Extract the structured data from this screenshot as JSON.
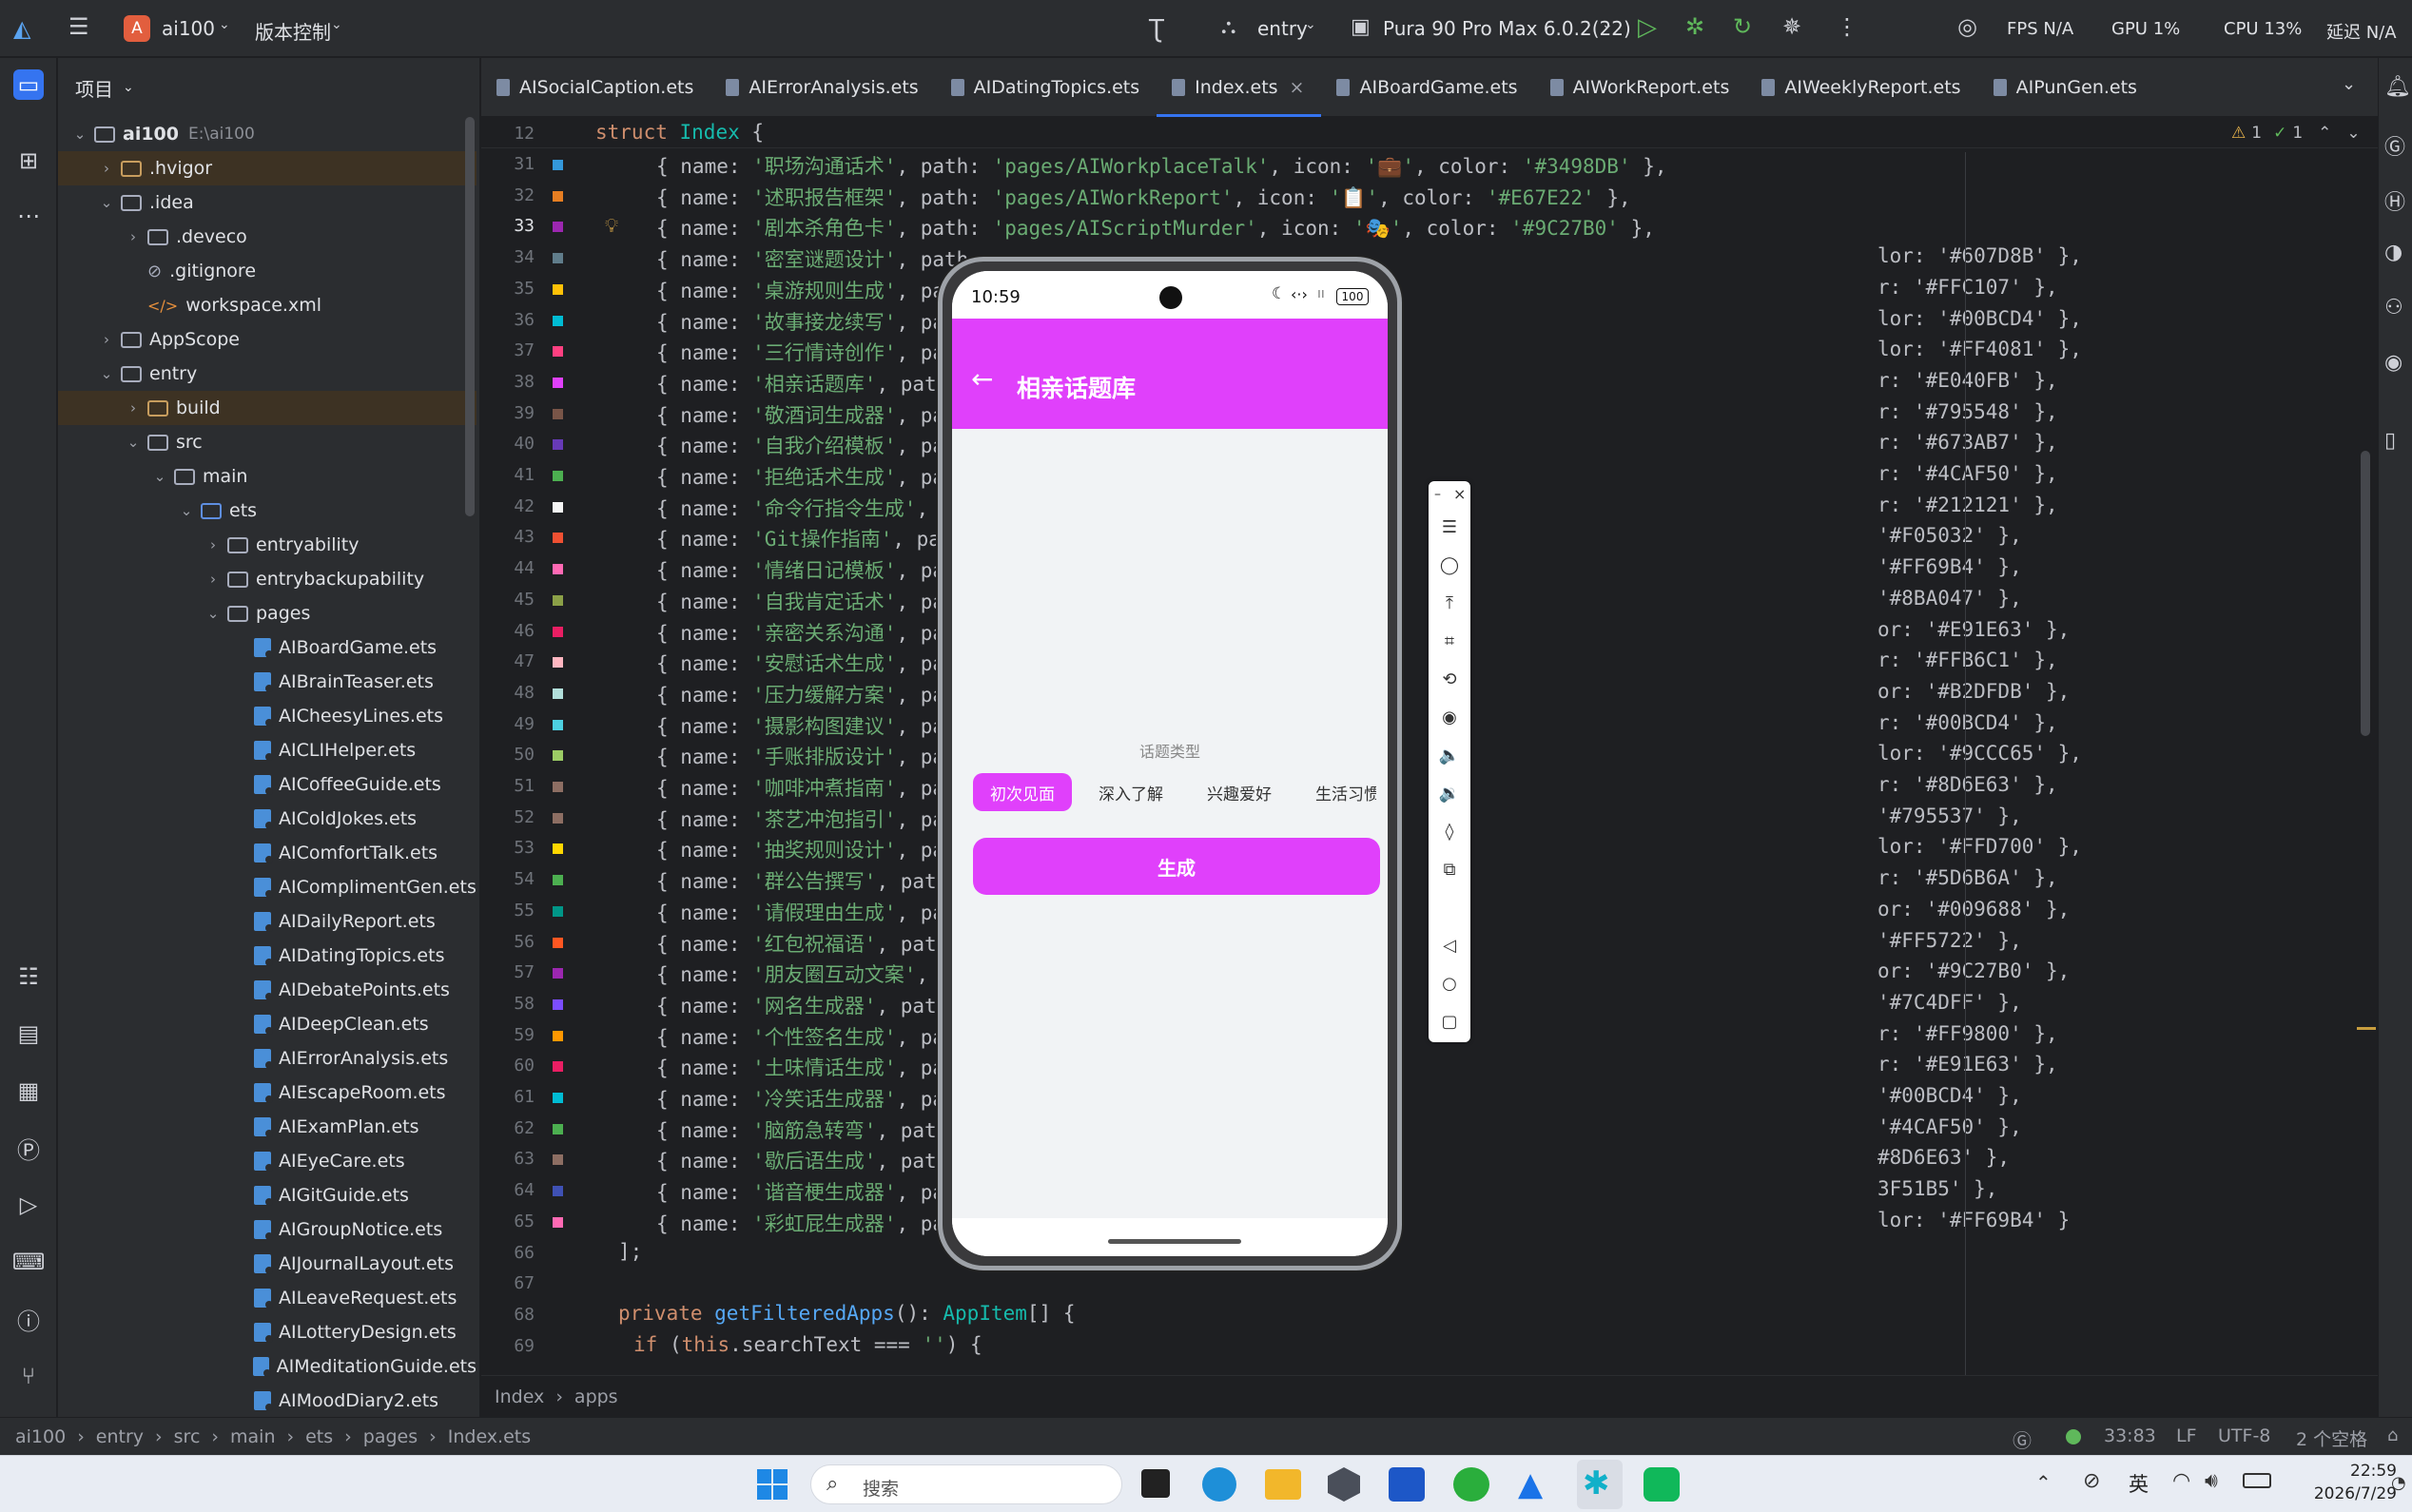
{
  "titlebar": {
    "project_badge": "A",
    "project_name": "ai100",
    "vcs": "版本控制",
    "run_config": "entry",
    "device": "Pura 90 Pro Max 6.0.2(22)",
    "fps": "FPS N/A",
    "gpu": "GPU 1%",
    "cpu": "CPU 13%",
    "latency": "延迟 N/A"
  },
  "project_panel": {
    "title": "项目",
    "tree": [
      {
        "label": "ai100",
        "hint": "E:\\ai100",
        "depth": 0,
        "kind": "root",
        "open": true
      },
      {
        "label": ".hvigor",
        "depth": 1,
        "kind": "folder-orange",
        "open": false
      },
      {
        "label": ".idea",
        "depth": 1,
        "kind": "folder",
        "open": true
      },
      {
        "label": ".deveco",
        "depth": 2,
        "kind": "folder",
        "open": false
      },
      {
        "label": ".gitignore",
        "depth": 2,
        "kind": "ignore"
      },
      {
        "label": "workspace.xml",
        "depth": 2,
        "kind": "xml"
      },
      {
        "label": "AppScope",
        "depth": 1,
        "kind": "folder",
        "open": false
      },
      {
        "label": "entry",
        "depth": 1,
        "kind": "folder",
        "open": true
      },
      {
        "label": "build",
        "depth": 2,
        "kind": "folder-orange",
        "open": false
      },
      {
        "label": "src",
        "depth": 2,
        "kind": "folder",
        "open": true
      },
      {
        "label": "main",
        "depth": 3,
        "kind": "folder",
        "open": true
      },
      {
        "label": "ets",
        "depth": 4,
        "kind": "folder-blue",
        "open": true
      },
      {
        "label": "entryability",
        "depth": 5,
        "kind": "folder",
        "open": false
      },
      {
        "label": "entrybackupability",
        "depth": 5,
        "kind": "folder",
        "open": false
      },
      {
        "label": "pages",
        "depth": 5,
        "kind": "folder",
        "open": true
      },
      {
        "label": "AIBoardGame.ets",
        "depth": 6,
        "kind": "ets"
      },
      {
        "label": "AIBrainTeaser.ets",
        "depth": 6,
        "kind": "ets"
      },
      {
        "label": "AICheesyLines.ets",
        "depth": 6,
        "kind": "ets"
      },
      {
        "label": "AICLIHelper.ets",
        "depth": 6,
        "kind": "ets"
      },
      {
        "label": "AICoffeeGuide.ets",
        "depth": 6,
        "kind": "ets"
      },
      {
        "label": "AIColdJokes.ets",
        "depth": 6,
        "kind": "ets"
      },
      {
        "label": "AIComfortTalk.ets",
        "depth": 6,
        "kind": "ets"
      },
      {
        "label": "AIComplimentGen.ets",
        "depth": 6,
        "kind": "ets"
      },
      {
        "label": "AIDailyReport.ets",
        "depth": 6,
        "kind": "ets"
      },
      {
        "label": "AIDatingTopics.ets",
        "depth": 6,
        "kind": "ets"
      },
      {
        "label": "AIDebatePoints.ets",
        "depth": 6,
        "kind": "ets"
      },
      {
        "label": "AIDeepClean.ets",
        "depth": 6,
        "kind": "ets"
      },
      {
        "label": "AIErrorAnalysis.ets",
        "depth": 6,
        "kind": "ets"
      },
      {
        "label": "AIEscapeRoom.ets",
        "depth": 6,
        "kind": "ets"
      },
      {
        "label": "AIExamPlan.ets",
        "depth": 6,
        "kind": "ets"
      },
      {
        "label": "AIEyeCare.ets",
        "depth": 6,
        "kind": "ets"
      },
      {
        "label": "AIGitGuide.ets",
        "depth": 6,
        "kind": "ets"
      },
      {
        "label": "AIGroupNotice.ets",
        "depth": 6,
        "kind": "ets"
      },
      {
        "label": "AIJournalLayout.ets",
        "depth": 6,
        "kind": "ets"
      },
      {
        "label": "AILeaveRequest.ets",
        "depth": 6,
        "kind": "ets"
      },
      {
        "label": "AILotteryDesign.ets",
        "depth": 6,
        "kind": "ets"
      },
      {
        "label": "AIMeditationGuide.ets",
        "depth": 6,
        "kind": "ets"
      },
      {
        "label": "AIMoodDiary2.ets",
        "depth": 6,
        "kind": "ets"
      }
    ]
  },
  "tabs": [
    {
      "label": "AISocialCaption.ets"
    },
    {
      "label": "AIErrorAnalysis.ets"
    },
    {
      "label": "AIDatingTopics.ets"
    },
    {
      "label": "Index.ets",
      "active": true
    },
    {
      "label": "AIBoardGame.ets"
    },
    {
      "label": "AIWorkReport.ets"
    },
    {
      "label": "AIWeeklyReport.ets"
    },
    {
      "label": "AIPunGen.ets"
    }
  ],
  "editor": {
    "inspections": {
      "warnings": "1",
      "ok": "1"
    },
    "sticky": {
      "line": "12",
      "code": "struct Index {"
    },
    "apps": [
      {
        "line": "31",
        "name": "职场沟通话术",
        "path": "pages/AIWorkplaceTalk",
        "icon": "💼",
        "color": "#3498DB"
      },
      {
        "line": "32",
        "name": "述职报告框架",
        "path": "pages/AIWorkReport",
        "icon": "📋",
        "color": "#E67E22"
      },
      {
        "line": "33",
        "name": "剧本杀角色卡",
        "path": "pages/AIScriptMurder",
        "icon": "🎭",
        "color": "#9C27B0"
      },
      {
        "line": "34",
        "name": "密室谜题设计",
        "path": "",
        "tail": "lor: '#607D8B' },",
        "color": "#607D8B"
      },
      {
        "line": "35",
        "name": "桌游规则生成",
        "path": "",
        "tail": "r: '#FFC107' },",
        "color": "#FFC107"
      },
      {
        "line": "36",
        "name": "故事接龙续写",
        "path": "",
        "tail": "lor: '#00BCD4' },",
        "color": "#00BCD4"
      },
      {
        "line": "37",
        "name": "三行情诗创作",
        "path": "",
        "tail": "lor: '#FF4081' },",
        "color": "#FF4081"
      },
      {
        "line": "38",
        "name": "相亲话题库",
        "path": "",
        "tail": "r: '#E040FB' },",
        "color": "#E040FB"
      },
      {
        "line": "39",
        "name": "敬酒词生成器",
        "path": "",
        "tail": "r: '#795548' },",
        "color": "#795548"
      },
      {
        "line": "40",
        "name": "自我介绍模板",
        "path": "",
        "tail": "r: '#673AB7' },",
        "color": "#673AB7"
      },
      {
        "line": "41",
        "name": "拒绝话术生成",
        "path": "",
        "tail": "r: '#4CAF50' },",
        "color": "#4CAF50"
      },
      {
        "line": "42",
        "name": "命令行指令生成",
        "path": "",
        "tail": "r: '#212121' },",
        "color": "#F5F5F5"
      },
      {
        "line": "43",
        "name": "Git操作指南",
        "path": "",
        "tail": "'#F05032' },",
        "color": "#F05032"
      },
      {
        "line": "44",
        "name": "情绪日记模板",
        "path": "",
        "tail": "'#FF69B4' },",
        "color": "#FF69B4"
      },
      {
        "line": "45",
        "name": "自我肯定话术",
        "path": "",
        "tail": "'#8BA047' },",
        "color": "#8BA047"
      },
      {
        "line": "46",
        "name": "亲密关系沟通",
        "path": "",
        "tail": "or: '#E91E63' },",
        "color": "#E91E63"
      },
      {
        "line": "47",
        "name": "安慰话术生成",
        "path": "",
        "tail": "r: '#FFB6C1' },",
        "color": "#FFB6C1"
      },
      {
        "line": "48",
        "name": "压力缓解方案",
        "path": "",
        "tail": "or: '#B2DFDB' },",
        "color": "#B2DFDB"
      },
      {
        "line": "49",
        "name": "摄影构图建议",
        "path": "",
        "tail": "r: '#00BCD4' },",
        "color": "#4DD0E1"
      },
      {
        "line": "50",
        "name": "手账排版设计",
        "path": "",
        "tail": "lor: '#9CCC65' },",
        "color": "#9CCC65"
      },
      {
        "line": "51",
        "name": "咖啡冲煮指南",
        "path": "",
        "tail": "r: '#8D6E63' },",
        "color": "#8D6E63"
      },
      {
        "line": "52",
        "name": "茶艺冲泡指引",
        "path": "",
        "tail": "'#795537' },",
        "color": "#8D6E63"
      },
      {
        "line": "53",
        "name": "抽奖规则设计",
        "path": "",
        "tail": "lor: '#FFD700' },",
        "color": "#FFD700"
      },
      {
        "line": "54",
        "name": "群公告撰写",
        "path": "",
        "tail": "r: '#5D6B6A' },",
        "color": "#4CAF50"
      },
      {
        "line": "55",
        "name": "请假理由生成",
        "path": "",
        "tail": "or: '#009688' },",
        "color": "#009688"
      },
      {
        "line": "56",
        "name": "红包祝福语",
        "path": "",
        "tail": "'#FF5722' },",
        "color": "#FF5722"
      },
      {
        "line": "57",
        "name": "朋友圈互动文案",
        "path": "",
        "tail": "or: '#9C27B0' },",
        "color": "#9C27B0"
      },
      {
        "line": "58",
        "name": "网名生成器",
        "path": "",
        "tail": "'#7C4DFF' },",
        "color": "#7C4DFF"
      },
      {
        "line": "59",
        "name": "个性签名生成",
        "path": "",
        "tail": "r: '#FF9800' },",
        "color": "#FF9800"
      },
      {
        "line": "60",
        "name": "土味情话生成",
        "path": "",
        "tail": "r: '#E91E63' },",
        "color": "#E91E63"
      },
      {
        "line": "61",
        "name": "冷笑话生成器",
        "path": "",
        "tail": "'#00BCD4' },",
        "color": "#00BCD4"
      },
      {
        "line": "62",
        "name": "脑筋急转弯",
        "path": "",
        "tail": "'#4CAF50' },",
        "color": "#4CAF50"
      },
      {
        "line": "63",
        "name": "歇后语生成",
        "path": "",
        "tail": "#8D6E63' },",
        "color": "#8D6E63"
      },
      {
        "line": "64",
        "name": "谐音梗生成器",
        "path": "",
        "tail": "3F51B5' },",
        "color": "#3F51B5"
      },
      {
        "line": "65",
        "name": "彩虹屁生成器",
        "path": "",
        "tail": "lor: '#FF69B4' }",
        "color": "#FF69B4"
      }
    ],
    "after": [
      {
        "line": "66",
        "code": "];"
      },
      {
        "line": "67",
        "code": ""
      },
      {
        "line": "68",
        "code": "private getFilteredApps(): AppItem[] {"
      },
      {
        "line": "69",
        "code": "  if (this.searchText === '') {"
      }
    ],
    "breadcrumb": [
      "Index",
      "apps"
    ]
  },
  "phone": {
    "time": "10:59",
    "battery": "100",
    "title": "相亲话题库",
    "topic_label": "话题类型",
    "chips": [
      "初次见面",
      "深入了解",
      "兴趣爱好",
      "生活习惯"
    ],
    "selected_chip": 0,
    "generate": "生成",
    "accent": "#E040FB"
  },
  "statusbar": {
    "path": [
      "ai100",
      "entry",
      "src",
      "main",
      "ets",
      "pages",
      "Index.ets"
    ],
    "position": "33:83",
    "line_sep": "LF",
    "encoding": "UTF-8",
    "indent": "2 个空格"
  },
  "taskbar": {
    "search": "搜索",
    "ime": "英",
    "time": "22:59",
    "date": "2026/7/29"
  }
}
